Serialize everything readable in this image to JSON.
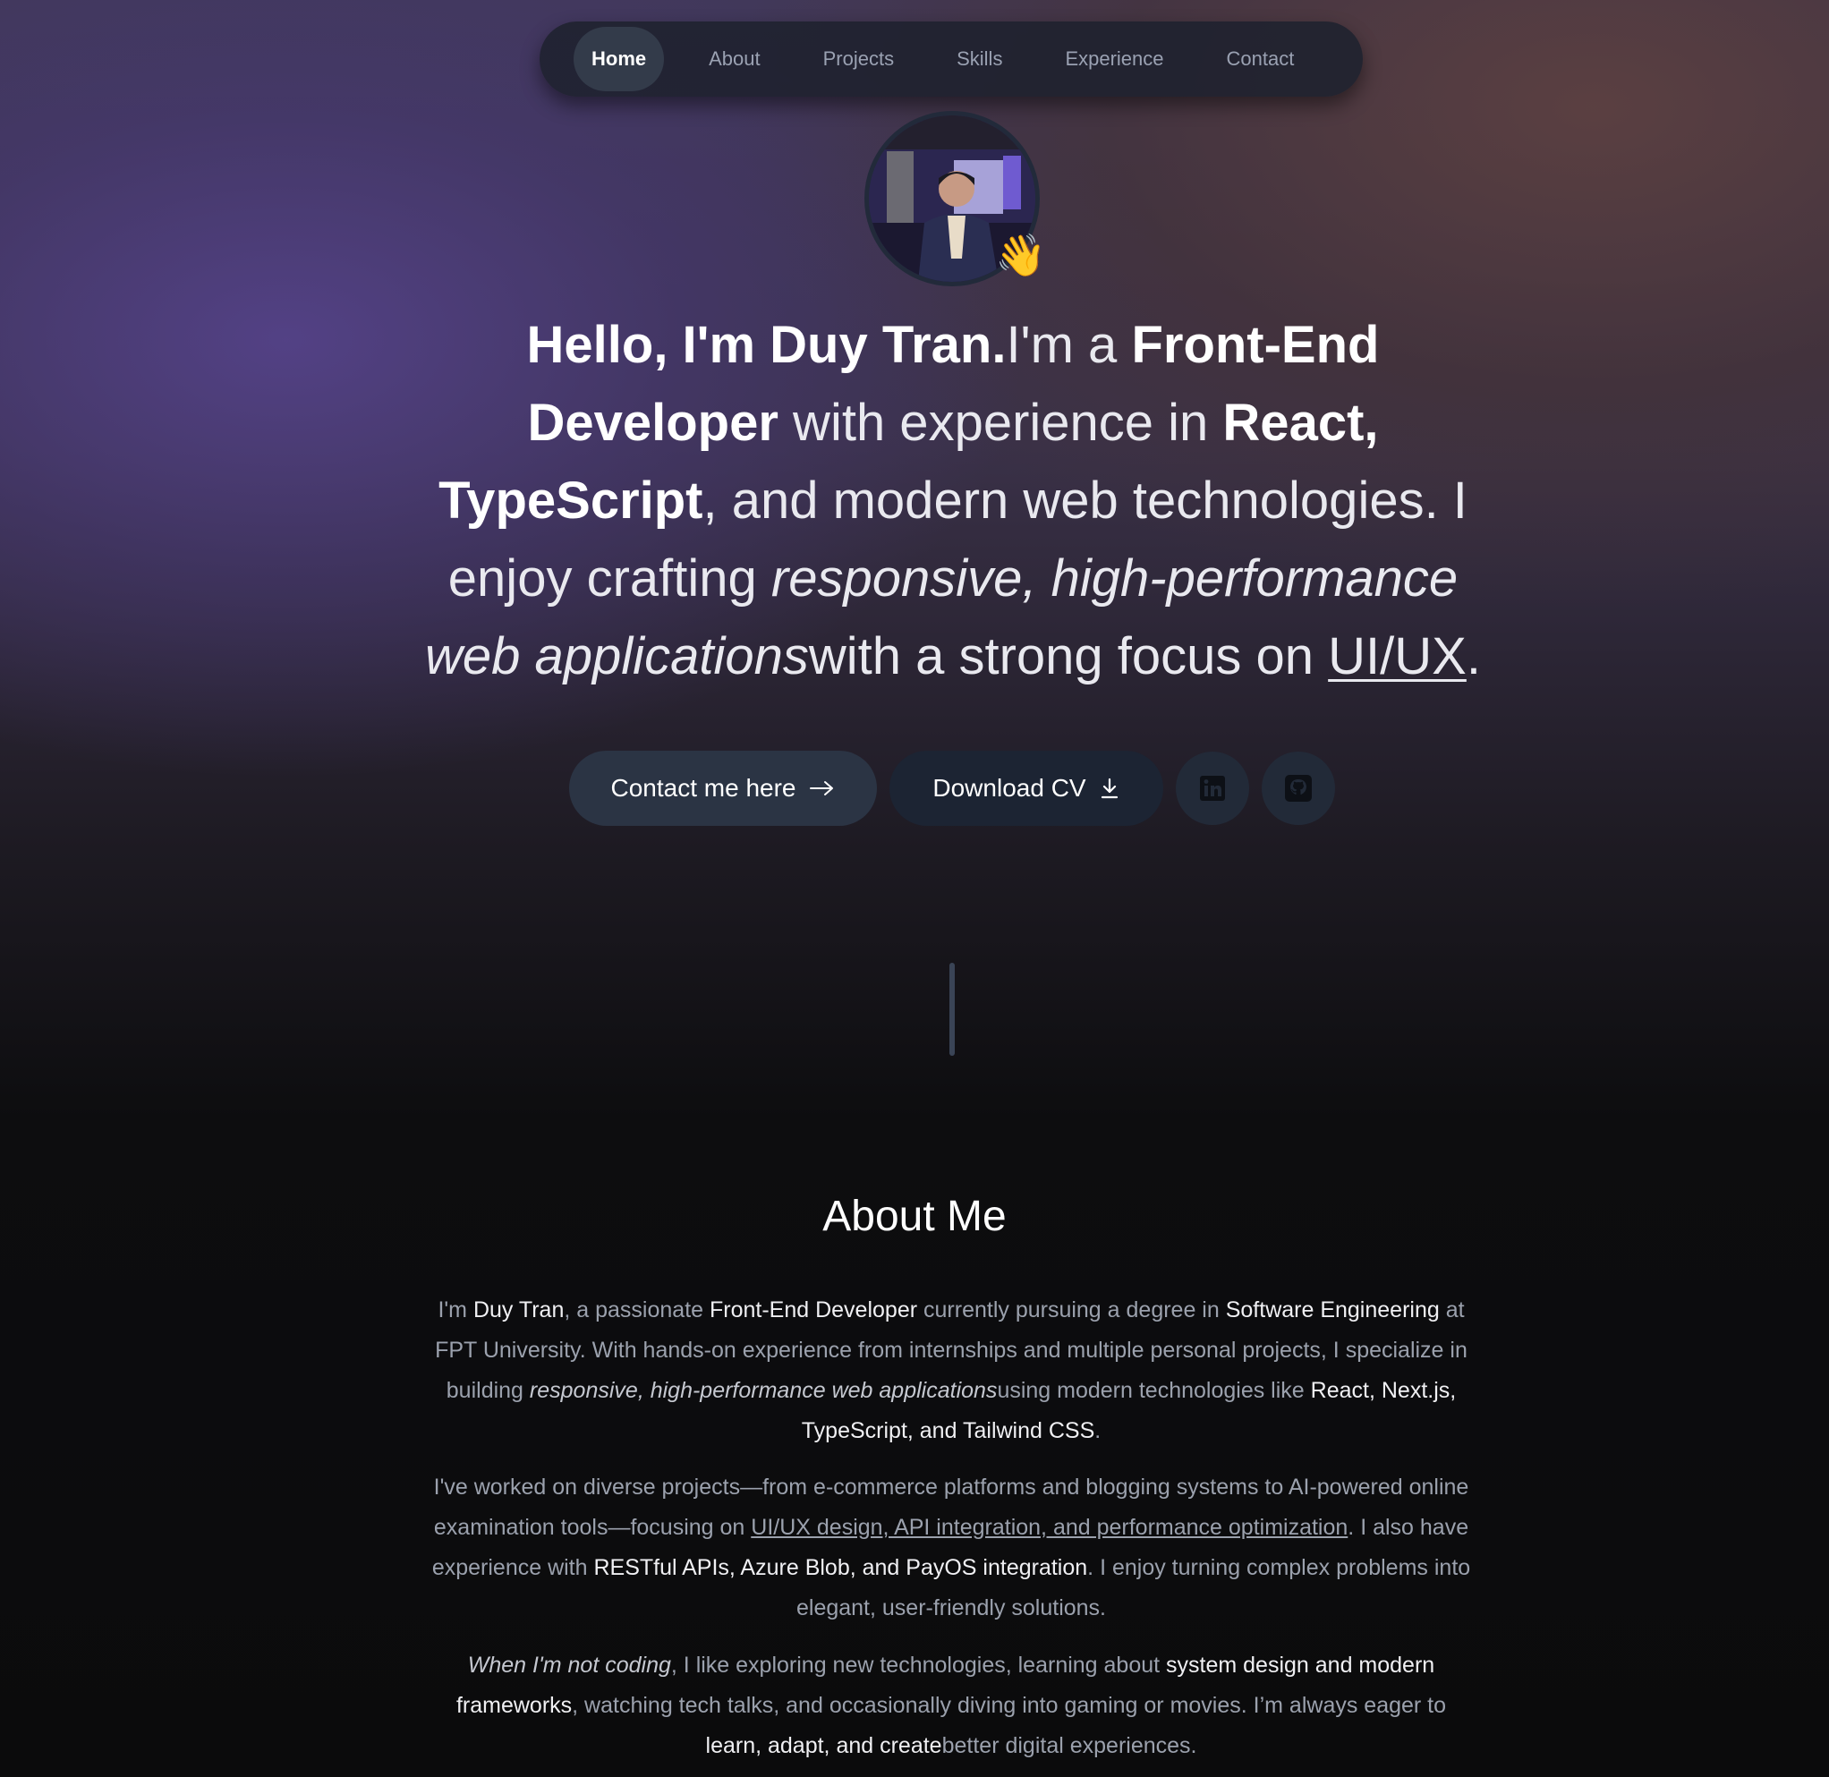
{
  "nav": {
    "items": [
      {
        "label": "Home",
        "active": true
      },
      {
        "label": "About",
        "active": false
      },
      {
        "label": "Projects",
        "active": false
      },
      {
        "label": "Skills",
        "active": false
      },
      {
        "label": "Experience",
        "active": false
      },
      {
        "label": "Contact",
        "active": false
      }
    ]
  },
  "hero": {
    "wave_emoji": "👋",
    "hello": "Hello, I'm Duy Tran.",
    "t1": "I'm a ",
    "role": "Front-End Developer",
    "t2": " with experience in ",
    "tech": "React, TypeScript",
    "t3": ", and modern web technologies. I enjoy crafting ",
    "emph": "responsive, high-performance web applications",
    "t4": "with a strong focus on ",
    "focus": "UI/UX",
    "t5": "."
  },
  "actions": {
    "contact_label": "Contact me here",
    "cv_label": "Download CV",
    "linkedin_icon": "linkedin-icon",
    "github_icon": "github-icon"
  },
  "about": {
    "title": "About Me",
    "p1": {
      "a": "I'm ",
      "name": "Duy Tran",
      "b": ", a passionate ",
      "role": "Front-End Developer",
      "c": " currently pursuing a degree in ",
      "degree": "Software Engineering",
      "d": " at FPT University. With hands-on experience from internships and multiple personal projects, I specialize in building ",
      "emph": "responsive, high-performance web applications",
      "e": "using modern technologies like ",
      "tech": "React, Next.js, TypeScript, and Tailwind CSS",
      "f": "."
    },
    "p2": {
      "a": "I've worked on diverse projects—from e-commerce platforms and blogging systems to AI-powered online examination tools—focusing on ",
      "focus": "UI/UX design, API integration, and performance optimization",
      "b": ". I also have experience with ",
      "apis": "RESTful APIs, Azure Blob, and PayOS integration",
      "c": ". I enjoy turning complex problems into elegant, user-friendly solutions."
    },
    "p3": {
      "emph": "When I'm not coding",
      "a": ", I like exploring new technologies, learning about ",
      "topics": "system design and modern frameworks",
      "b": ", watching tech talks, and occasionally diving into gaming or movies. I’m always eager to ",
      "goal": "learn, adapt, and create",
      "c": "better digital experiences."
    }
  },
  "colors": {
    "nav_bg": "#1e212d",
    "nav_active": "#333b4a",
    "btn_primary": "#2b3444",
    "btn_secondary": "#1c2433"
  }
}
